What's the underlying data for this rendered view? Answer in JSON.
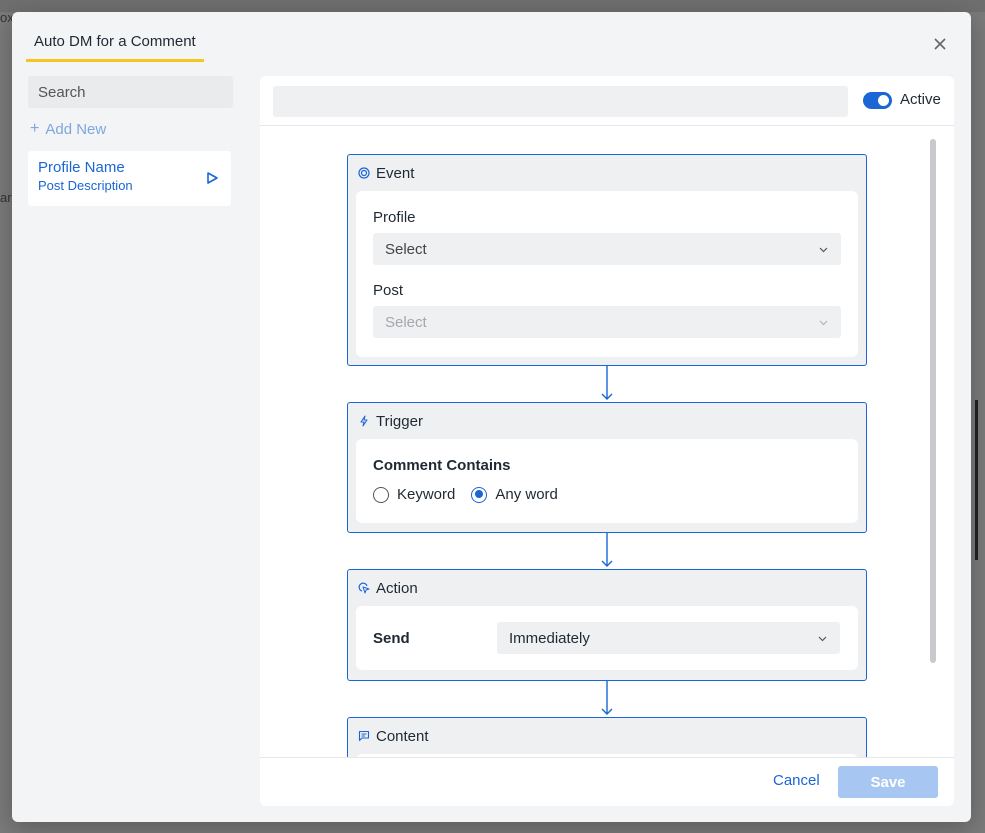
{
  "background": {
    "fragment_top": "ox",
    "fragment_mid": "ar"
  },
  "modal": {
    "tab_title": "Auto DM for a Comment",
    "close_icon": "close-icon"
  },
  "sidebar": {
    "search_placeholder": "Search",
    "search_icon": "search-icon",
    "add_new_label": "Add New",
    "items": [
      {
        "name": "Profile Name",
        "description": "Post Description",
        "icon": "play-icon"
      }
    ]
  },
  "editor": {
    "name_value": "",
    "active_label": "Active",
    "active": true,
    "nodes": {
      "event": {
        "title": "Event",
        "icon": "target-icon",
        "profile_label": "Profile",
        "profile_value": "Select",
        "post_label": "Post",
        "post_value": "Select"
      },
      "trigger": {
        "title": "Trigger",
        "icon": "lightning-icon",
        "condition_label": "Comment Contains",
        "options": [
          "Keyword",
          "Any word"
        ],
        "selected": "Any word"
      },
      "action": {
        "title": "Action",
        "icon": "cursor-click-icon",
        "send_label": "Send",
        "send_value": "Immediately"
      },
      "content": {
        "title": "Content",
        "icon": "message-icon"
      }
    },
    "footer": {
      "cancel_label": "Cancel",
      "save_label": "Save"
    }
  },
  "colors": {
    "accent": "#1a66d6",
    "tab_underline": "#f7c520",
    "save_disabled": "#a8c6f2"
  }
}
